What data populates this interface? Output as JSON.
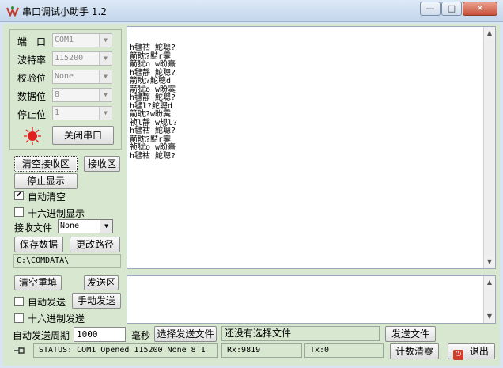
{
  "window": {
    "title": "串口调试小助手 1.2",
    "controls": {
      "minimize": "—",
      "maximize": "□",
      "close": "✕"
    }
  },
  "settings": {
    "port": {
      "label": "端　口",
      "value": "COM1"
    },
    "baud": {
      "label": "波特率",
      "value": "115200"
    },
    "parity": {
      "label": "校验位",
      "value": "None"
    },
    "databits": {
      "label": "数据位",
      "value": "8"
    },
    "stopbits": {
      "label": "停止位",
      "value": "1"
    },
    "toggle_port_label": "关闭串口"
  },
  "receive": {
    "clear_button": "清空接收区",
    "area_label": "接收区",
    "stop_display_button": "停止显示",
    "auto_clear_label": "自动清空",
    "hex_display_label": "十六进制显示",
    "file_label": "接收文件",
    "file_select": "None",
    "save_button": "保存数据",
    "change_path_button": "更改路径",
    "path": "C:\\COMDATA\\",
    "lines": [
      "h毽祜 鮀聰?",
      "箭眈?黠r霙",
      "箭犹o w盼熹",
      "h毽靜 鮀聰?",
      "箭眈?鮀聰d",
      "箭犹o w盼霙",
      "h毽靜 鮀聰?",
      "h毽l?鮀聰d",
      "箭眈?w盼霙",
      "祯l靜 w规l?",
      "h毽祜 鮀聰?",
      "箭眈?黠r霙",
      "祯犹o w盼熹",
      "h毽祜 鮀聰?"
    ]
  },
  "send": {
    "clear_button": "清空重填",
    "area_label": "发送区",
    "auto_send_label": "自动发送",
    "manual_send_button": "手动发送",
    "hex_send_label": "十六进制发送",
    "period_label": "自动发送周期",
    "period_value": "1000",
    "ms_label": "毫秒",
    "select_file_button": "选择发送文件",
    "file_status": "还没有选择文件",
    "send_file_button": "发送文件",
    "count_clear_button": "计数清零",
    "exit_button": "退出"
  },
  "status": {
    "text": "STATUS: COM1 Opened 115200 None 8 1",
    "rx": "Rx:9819",
    "tx": "Tx:0"
  },
  "colors": {
    "led": "#e02020",
    "close_button": "#c75139",
    "panel": "#d8e7d0"
  }
}
